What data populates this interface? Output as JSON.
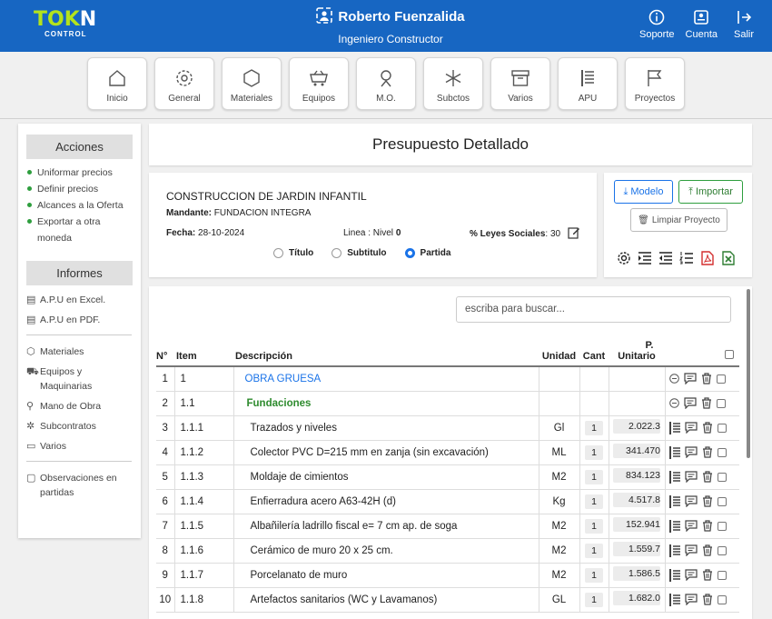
{
  "brand": {
    "logo_main_a": "TOK",
    "logo_main_b": "N",
    "logo_sub": "CONTROL"
  },
  "user": {
    "name": "Roberto Fuenzalida",
    "role": "Ingeniero Constructor"
  },
  "topnav": [
    {
      "label": "Soporte",
      "icon": "info-icon"
    },
    {
      "label": "Cuenta",
      "icon": "account-icon"
    },
    {
      "label": "Salir",
      "icon": "logout-icon"
    }
  ],
  "menu": [
    {
      "label": "Inicio",
      "icon": "home-icon"
    },
    {
      "label": "General",
      "icon": "gear-icon"
    },
    {
      "label": "Materiales",
      "icon": "hexagon-icon"
    },
    {
      "label": "Equipos",
      "icon": "cart-icon"
    },
    {
      "label": "M.O.",
      "icon": "worker-icon"
    },
    {
      "label": "Subctos",
      "icon": "snowflake-icon"
    },
    {
      "label": "Varios",
      "icon": "archive-icon"
    },
    {
      "label": "APU",
      "icon": "list-icon"
    },
    {
      "label": "Proyectos",
      "icon": "flag-icon"
    }
  ],
  "sidebar": {
    "acciones_title": "Acciones",
    "acciones": [
      "Uniformar precios",
      "Definir precios",
      "Alcances a la Oferta",
      "Exportar a otra moneda"
    ],
    "informes_title": "Informes",
    "informes": [
      "A.P.U en Excel.",
      "A.P.U en PDF."
    ],
    "catalogos": [
      {
        "label": "Materiales",
        "icon": "hexagon-icon"
      },
      {
        "label": "Equipos y Maquinarias",
        "icon": "cart-icon"
      },
      {
        "label": "Mano de Obra",
        "icon": "worker-icon"
      },
      {
        "label": "Subcontratos",
        "icon": "snowflake-icon"
      },
      {
        "label": "Varios",
        "icon": "archive-icon"
      }
    ],
    "observaciones": "Observaciones en partidas"
  },
  "page_title": "Presupuesto Detallado",
  "project": {
    "name": "CONSTRUCCION DE JARDIN INFANTIL",
    "mandante_label": "Mandante",
    "mandante": "FUNDACION INTEGRA",
    "fecha_label": "Fecha",
    "fecha": "28-10-2024",
    "linea_label": "Linea : Nivel",
    "nivel": "0",
    "leyes_label": "% Leyes Sociales",
    "leyes": "30",
    "radio_titulo": "Título",
    "radio_subtitulo": "Subtitulo",
    "radio_partida": "Partida",
    "selected": "Partida"
  },
  "actions": {
    "modelo": "Modelo",
    "importar": "Importar",
    "limpiar": "Limpiar Proyecto"
  },
  "colors": {
    "header_blue": "#1766c2",
    "logo_green": "#b4e31c",
    "title_blue": "#1a73e8",
    "subtitle_green": "#2e8b2e"
  },
  "table": {
    "search_placeholder": "escriba para buscar...",
    "headers": {
      "n": "N°",
      "item": "Item",
      "desc": "Descripción",
      "unidad": "Unidad",
      "cant": "Cant",
      "pu_a": "P.",
      "pu_b": "Unitario"
    },
    "rows": [
      {
        "n": "1",
        "item": "1",
        "desc": "OBRA GRUESA",
        "unidad": "",
        "cant": "",
        "pu": "",
        "kind": "titulo"
      },
      {
        "n": "2",
        "item": "1.1",
        "desc": "Fundaciones",
        "unidad": "",
        "cant": "",
        "pu": "",
        "kind": "subtitulo"
      },
      {
        "n": "3",
        "item": "1.1.1",
        "desc": "Trazados y niveles",
        "unidad": "Gl",
        "cant": "1",
        "pu": "2.022.3",
        "kind": "partida"
      },
      {
        "n": "4",
        "item": "1.1.2",
        "desc": "Colector PVC D=215 mm en zanja (sin excavación)",
        "unidad": "ML",
        "cant": "1",
        "pu": "341.470",
        "kind": "partida"
      },
      {
        "n": "5",
        "item": "1.1.3",
        "desc": "Moldaje de cimientos",
        "unidad": "M2",
        "cant": "1",
        "pu": "834.123",
        "kind": "partida"
      },
      {
        "n": "6",
        "item": "1.1.4",
        "desc": "Enfierradura acero A63-42H (d)",
        "unidad": "Kg",
        "cant": "1",
        "pu": "4.517.8",
        "kind": "partida"
      },
      {
        "n": "7",
        "item": "1.1.5",
        "desc": "Albañilería ladrillo fiscal e= 7 cm ap. de soga",
        "unidad": "M2",
        "cant": "1",
        "pu": "152.941",
        "kind": "partida"
      },
      {
        "n": "8",
        "item": "1.1.6",
        "desc": "Cerámico de muro 20 x 25 cm.",
        "unidad": "M2",
        "cant": "1",
        "pu": "1.559.7",
        "kind": "partida"
      },
      {
        "n": "9",
        "item": "1.1.7",
        "desc": "Porcelanato de muro",
        "unidad": "M2",
        "cant": "1",
        "pu": "1.586.5",
        "kind": "partida"
      },
      {
        "n": "10",
        "item": "1.1.8",
        "desc": "Artefactos sanitarios (WC  y Lavamanos)",
        "unidad": "GL",
        "cant": "1",
        "pu": "1.682.0",
        "kind": "partida"
      }
    ]
  }
}
